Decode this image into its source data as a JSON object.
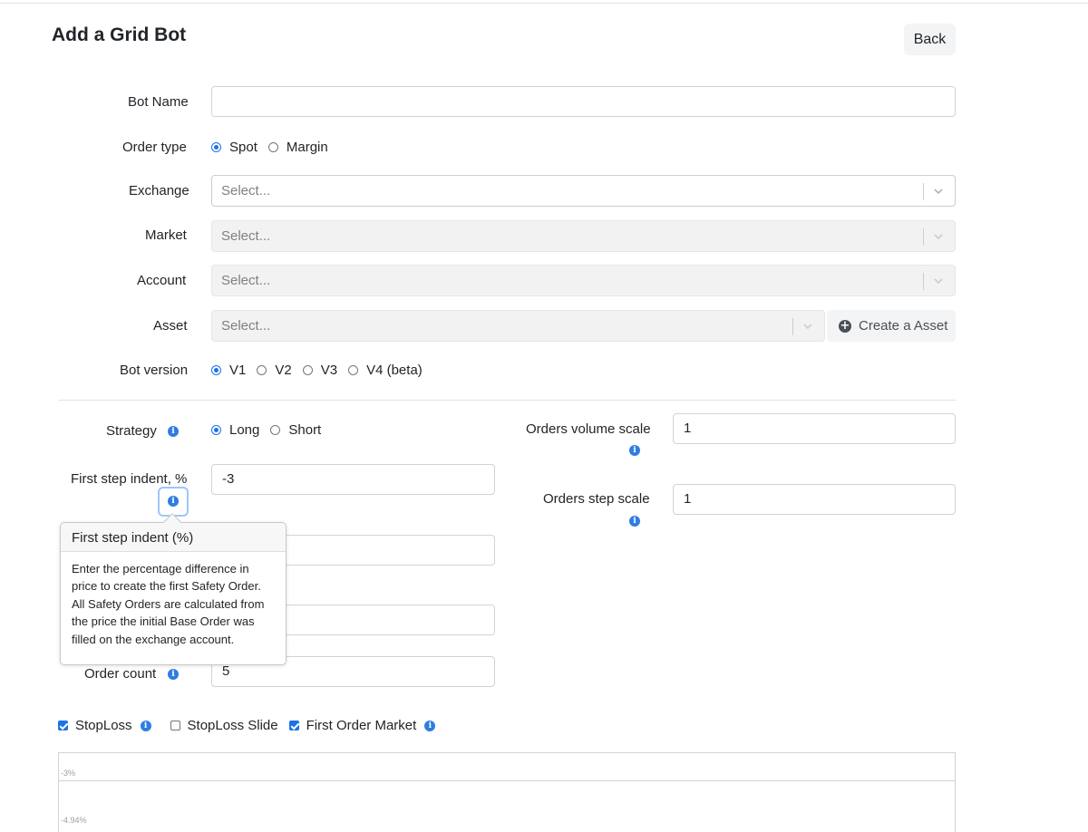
{
  "page": {
    "title": "Add a Grid Bot",
    "back_label": "Back"
  },
  "form": {
    "bot_name": {
      "label": "Bot Name",
      "value": ""
    },
    "order_type": {
      "label": "Order type",
      "options": [
        "Spot",
        "Margin"
      ],
      "selected": "Spot"
    },
    "exchange": {
      "label": "Exchange",
      "placeholder": "Select..."
    },
    "market": {
      "label": "Market",
      "placeholder": "Select..."
    },
    "account": {
      "label": "Account",
      "placeholder": "Select..."
    },
    "asset": {
      "label": "Asset",
      "placeholder": "Select...",
      "create_label": "Create a Asset"
    },
    "bot_version": {
      "label": "Bot version",
      "options": [
        "V1",
        "V2",
        "V3",
        "V4 (beta)"
      ],
      "selected": "V1"
    },
    "strategy": {
      "label": "Strategy",
      "options": [
        "Long",
        "Short"
      ],
      "selected": "Long"
    },
    "first_step_indent": {
      "label": "First step indent, %",
      "value": "-3"
    },
    "order_count": {
      "label": "Order count",
      "value": "5"
    },
    "orders_volume_scale": {
      "label": "Orders volume scale",
      "value": "1"
    },
    "orders_step_scale": {
      "label": "Orders step scale",
      "value": "1"
    }
  },
  "tooltip": {
    "title": "First step indent (%)",
    "body": "Enter the percentage difference in price to create the first Safety Order. All Safety Orders are calculated from the price the initial Base Order was filled on the exchange account."
  },
  "options": {
    "stoploss": {
      "label": "StopLoss",
      "checked": true
    },
    "stoploss_slide": {
      "label": "StopLoss Slide",
      "checked": false
    },
    "first_order_market": {
      "label": "First Order Market",
      "checked": true
    }
  },
  "preview": {
    "levels": [
      "-3%",
      "-4.94%"
    ]
  },
  "colors": {
    "accent": "#1a73e8",
    "info": "#2f7de1"
  }
}
